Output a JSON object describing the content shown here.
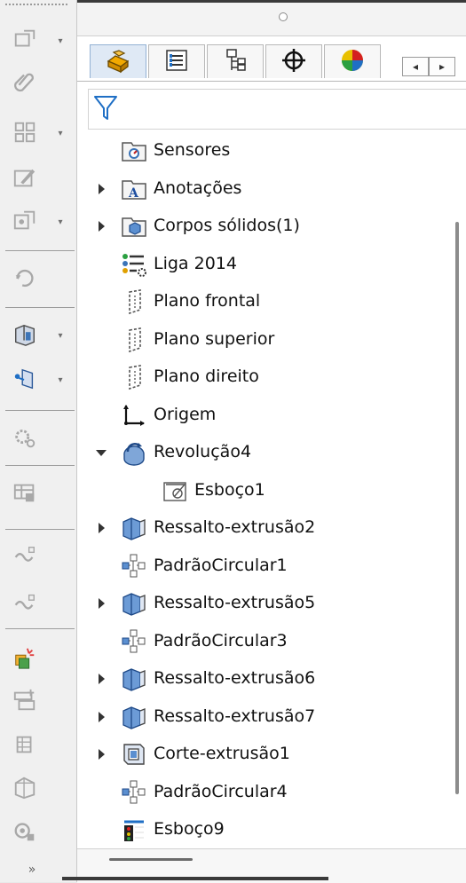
{
  "toolbar": {
    "buttons": [
      {
        "icon": "sketch-icon",
        "has_dropdown": true
      },
      {
        "icon": "paperclip-icon",
        "has_dropdown": false
      },
      {
        "icon": "grid-icon",
        "has_dropdown": true
      },
      {
        "icon": "edit-sketch-icon",
        "has_dropdown": false
      },
      {
        "icon": "component-icon",
        "has_dropdown": true
      },
      {
        "icon": "rotate-icon",
        "has_dropdown": false
      },
      {
        "icon": "box-feature-icon",
        "has_dropdown": true
      },
      {
        "icon": "reference-plane-icon",
        "has_dropdown": true
      },
      {
        "icon": "gears-icon",
        "has_dropdown": false
      },
      {
        "icon": "table-icon",
        "has_dropdown": false
      },
      {
        "icon": "spring-icon",
        "has_dropdown": false
      },
      {
        "icon": "spring2-icon",
        "has_dropdown": false
      },
      {
        "icon": "instant3d-icon",
        "has_dropdown": false
      },
      {
        "icon": "section-icon",
        "has_dropdown": false
      },
      {
        "icon": "explode-icon",
        "has_dropdown": false
      },
      {
        "icon": "assembly-icon",
        "has_dropdown": false
      },
      {
        "icon": "camera-icon",
        "has_dropdown": false
      }
    ],
    "more_glyph": "»"
  },
  "tabs": [
    {
      "name": "feature-manager-tab",
      "icon": "feature-tree-icon",
      "active": true
    },
    {
      "name": "property-manager-tab",
      "icon": "property-list-icon",
      "active": false
    },
    {
      "name": "configuration-manager-tab",
      "icon": "configuration-icon",
      "active": false
    },
    {
      "name": "dimxpert-tab",
      "icon": "crosshair-icon",
      "active": false
    },
    {
      "name": "display-manager-tab",
      "icon": "color-ball-icon",
      "active": false
    }
  ],
  "tab_scroll": {
    "left": "◂",
    "right": "▸"
  },
  "tree": {
    "items": [
      {
        "label": "Sensores",
        "icon": "sensors-icon",
        "expander": "none",
        "indent": 0
      },
      {
        "label": "Anotações",
        "icon": "annotations-icon",
        "expander": "collapsed",
        "indent": 0
      },
      {
        "label": "Corpos sólidos(1)",
        "icon": "solid-bodies-icon",
        "expander": "collapsed",
        "indent": 0
      },
      {
        "label": "Liga 2014",
        "icon": "material-icon",
        "expander": "none",
        "indent": 0
      },
      {
        "label": "Plano frontal",
        "icon": "plane-icon",
        "expander": "none",
        "indent": 0
      },
      {
        "label": "Plano superior",
        "icon": "plane-icon",
        "expander": "none",
        "indent": 0
      },
      {
        "label": "Plano direito",
        "icon": "plane-icon",
        "expander": "none",
        "indent": 0
      },
      {
        "label": "Origem",
        "icon": "origin-icon",
        "expander": "none",
        "indent": 0
      },
      {
        "label": "Revolução4",
        "icon": "revolve-icon",
        "expander": "expanded",
        "indent": 0
      },
      {
        "label": "Esboço1",
        "icon": "sketch-icon",
        "expander": "none",
        "indent": 1
      },
      {
        "label": "Ressalto-extrusão2",
        "icon": "boss-extrude-icon",
        "expander": "collapsed",
        "indent": 0
      },
      {
        "label": "PadrãoCircular1",
        "icon": "circular-pattern-icon",
        "expander": "none",
        "indent": 0
      },
      {
        "label": "Ressalto-extrusão5",
        "icon": "boss-extrude-icon",
        "expander": "collapsed",
        "indent": 0
      },
      {
        "label": "PadrãoCircular3",
        "icon": "circular-pattern-icon",
        "expander": "none",
        "indent": 0
      },
      {
        "label": "Ressalto-extrusão6",
        "icon": "boss-extrude-icon",
        "expander": "collapsed",
        "indent": 0
      },
      {
        "label": "Ressalto-extrusão7",
        "icon": "boss-extrude-icon",
        "expander": "collapsed",
        "indent": 0
      },
      {
        "label": "Corte-extrusão1",
        "icon": "cut-extrude-icon",
        "expander": "collapsed",
        "indent": 0
      },
      {
        "label": "PadrãoCircular4",
        "icon": "circular-pattern-icon",
        "expander": "none",
        "indent": 0
      },
      {
        "label": "Esboço9",
        "icon": "sketch-flagged-icon",
        "expander": "none",
        "indent": 0
      }
    ]
  },
  "colors": {
    "accent_blue": "#1f6fc5",
    "folder_blue": "#3b74b8",
    "icon_gray": "#9a9a9a"
  }
}
